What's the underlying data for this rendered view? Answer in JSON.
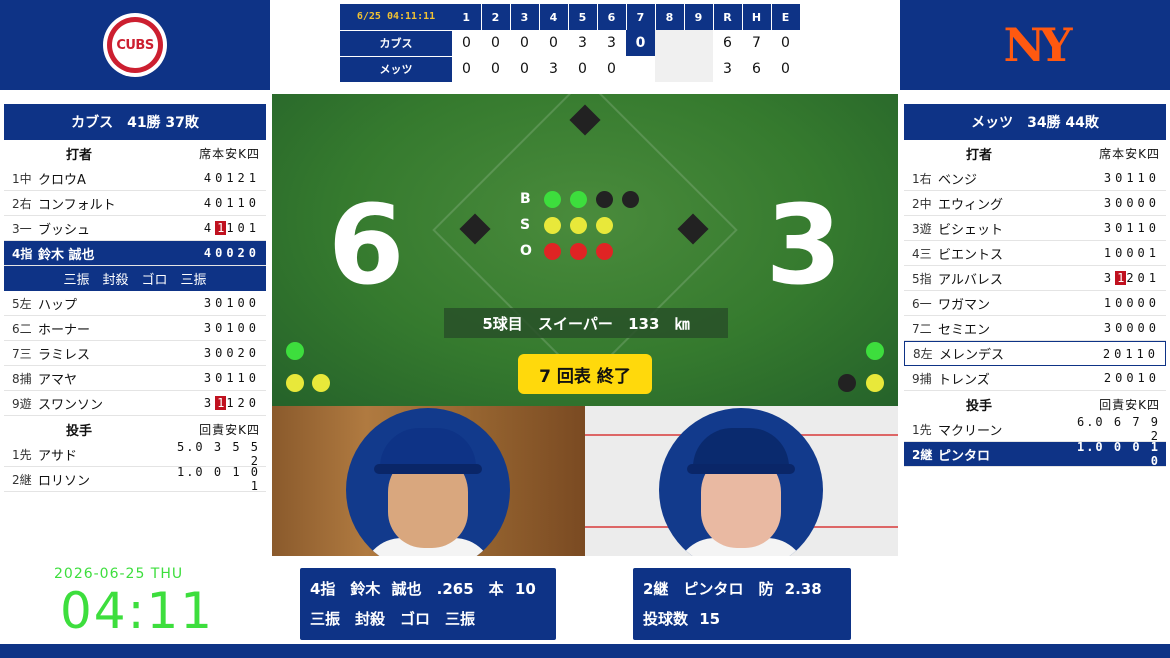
{
  "colors": {
    "team_blue": "#0e3386",
    "cubs_red": "#cc1f30",
    "mets_orange": "#ff5910",
    "field_green": "#357a2e",
    "inning_yellow": "#ffd90c",
    "clock_green": "#3dde3d"
  },
  "away_logo": {
    "text": "CUBS",
    "icon": "cubs-logo"
  },
  "home_logo": {
    "text": "NY",
    "icon": "mets-logo"
  },
  "linescore": {
    "datetime": "6/25 04:11:11",
    "innings": [
      "1",
      "2",
      "3",
      "4",
      "5",
      "6",
      "7",
      "8",
      "9"
    ],
    "totals_headers": [
      "R",
      "H",
      "E"
    ],
    "away": {
      "name": "カブス",
      "innings": [
        "0",
        "0",
        "0",
        "0",
        "3",
        "3",
        "0",
        "",
        ""
      ],
      "R": "6",
      "H": "7",
      "E": "0"
    },
    "home": {
      "name": "メッツ",
      "innings": [
        "0",
        "0",
        "0",
        "3",
        "0",
        "0",
        "",
        "",
        ""
      ],
      "R": "3",
      "H": "6",
      "E": "0"
    }
  },
  "away": {
    "header": "カブス　41勝 37敗",
    "batters_label": "打者",
    "batters_cols": "席本安K四",
    "batters": [
      {
        "order": "1中",
        "name": "クロウA",
        "stats": "40121"
      },
      {
        "order": "2右",
        "name": "コンフォルト",
        "stats": "40110"
      },
      {
        "order": "3一",
        "name": "ブッシュ",
        "stats_pre": "4",
        "stats_red": "1",
        "stats_post": "101"
      },
      {
        "order": "4指",
        "name": "鈴木 誠也",
        "stats": "40020"
      },
      {
        "order": "5左",
        "name": "ハップ",
        "stats": "30100"
      },
      {
        "order": "6二",
        "name": "ホーナー",
        "stats": "30100"
      },
      {
        "order": "7三",
        "name": "ラミレス",
        "stats": "30020"
      },
      {
        "order": "8捕",
        "name": "アマヤ",
        "stats": "30110"
      },
      {
        "order": "9遊",
        "name": "スワンソン",
        "stats_pre": "3",
        "stats_red": "1",
        "stats_post": "120"
      }
    ],
    "current_batter_results": "三振　封殺　ゴロ　三振",
    "pitchers_label": "投手",
    "pitchers_cols": "回責安K四",
    "pitchers": [
      {
        "order": "1先",
        "name": "アサド",
        "stats": "5.0 3 5 5 2"
      },
      {
        "order": "2継",
        "name": "ロリソン",
        "stats": "1.0 0 1 0 1"
      }
    ]
  },
  "home": {
    "header": "メッツ　34勝 44敗",
    "batters_label": "打者",
    "batters_cols": "席本安K四",
    "batters": [
      {
        "order": "1右",
        "name": "ベンジ",
        "stats": "30110"
      },
      {
        "order": "2中",
        "name": "エウィング",
        "stats": "30000"
      },
      {
        "order": "3遊",
        "name": "ビシェット",
        "stats": "30110"
      },
      {
        "order": "4三",
        "name": "ビエントス",
        "stats": "10001"
      },
      {
        "order": "5指",
        "name": "アルバレス",
        "stats_pre": "3",
        "stats_red": "1",
        "stats_post": "201"
      },
      {
        "order": "6一",
        "name": "ワガマン",
        "stats": "10000"
      },
      {
        "order": "7二",
        "name": "セミエン",
        "stats": "30000"
      },
      {
        "order": "8左",
        "name": "メレンデス",
        "stats": "20110"
      },
      {
        "order": "9捕",
        "name": "トレンズ",
        "stats": "20010"
      }
    ],
    "pitchers_label": "投手",
    "pitchers_cols": "回責安K四",
    "pitchers": [
      {
        "order": "1先",
        "name": "マクリーン",
        "stats": "6.0 6 7 9 2"
      },
      {
        "order": "2継",
        "name": "ピンタロ",
        "stats": "1.0 0 0 1 0"
      }
    ]
  },
  "field": {
    "away_score": "6",
    "home_score": "3",
    "bso_labels": [
      "B",
      "S",
      "O"
    ],
    "balls": 2,
    "strikes": 3,
    "outs": 3,
    "pitch_info": "5球目 スイーパー 133 ㎞",
    "inning_status": "7 回表 終了"
  },
  "batter_box": {
    "line1": "4指　鈴木 誠也　.265　本 10",
    "line2": "三振　封殺　ゴロ　三振"
  },
  "pitcher_box": {
    "line1": "2継　ピンタロ　防 2.38",
    "line2": "投球数 15"
  },
  "clock": {
    "date": "2026-06-25 THU",
    "time": "04:11"
  }
}
